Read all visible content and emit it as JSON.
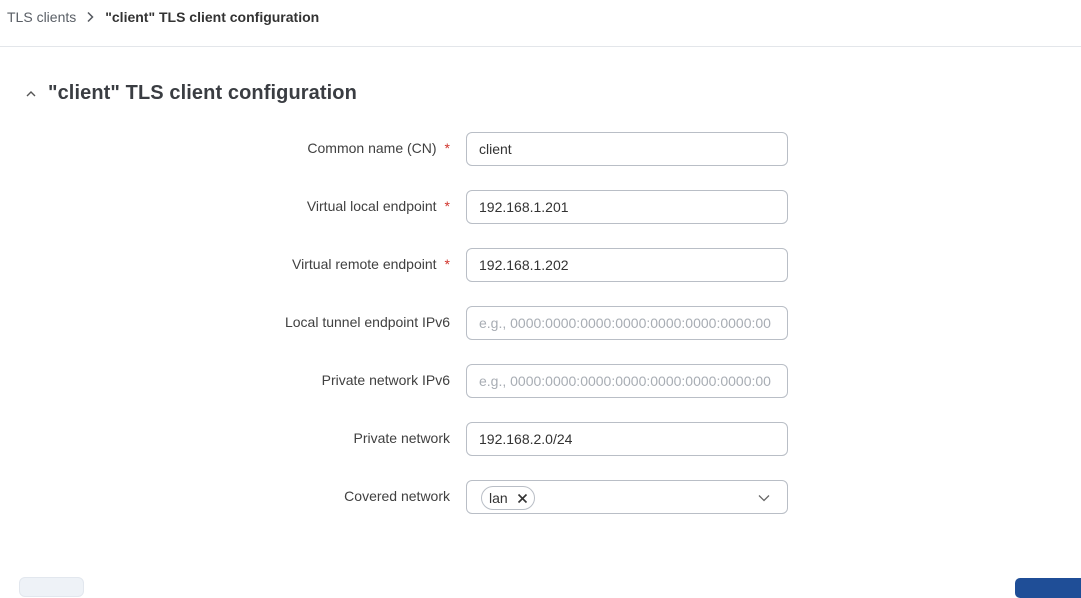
{
  "breadcrumb": {
    "parent": "TLS clients",
    "current": "\"client\" TLS client configuration"
  },
  "section": {
    "title": "\"client\" TLS client configuration",
    "collapse_icon": "chevron-up-icon"
  },
  "form": {
    "common_name": {
      "label": "Common name (CN)",
      "required_mark": "*",
      "value": "client"
    },
    "virtual_local_endpoint": {
      "label": "Virtual local endpoint",
      "required_mark": "*",
      "value": "192.168.1.201"
    },
    "virtual_remote_endpoint": {
      "label": "Virtual remote endpoint",
      "required_mark": "*",
      "value": "192.168.1.202"
    },
    "local_tunnel_endpoint_ipv6": {
      "label": "Local tunnel endpoint IPv6",
      "value": "",
      "placeholder": "e.g., 0000:0000:0000:0000:0000:0000:0000:00"
    },
    "private_network_ipv6": {
      "label": "Private network IPv6",
      "value": "",
      "placeholder": "e.g., 0000:0000:0000:0000:0000:0000:0000:00"
    },
    "private_network": {
      "label": "Private network",
      "value": "192.168.2.0/24"
    },
    "covered_network": {
      "label": "Covered network",
      "selected": [
        "lan"
      ]
    }
  },
  "colors": {
    "required": "#d0342c",
    "primary_button": "#1f4e97",
    "input_border": "#b9bec6"
  }
}
